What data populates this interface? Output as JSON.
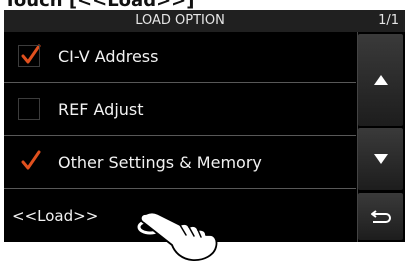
{
  "top_caption_partial": "Touch [<<Load>>]",
  "screen": {
    "title": "LOAD OPTION",
    "page_indicator": "1/1",
    "options": [
      {
        "label": "CI-V Address",
        "checked": true
      },
      {
        "label": "REF Adjust",
        "checked": false
      },
      {
        "label": "Other Settings & Memory",
        "checked": true
      }
    ],
    "load_label": "<<Load>>",
    "buttons": {
      "up": "up-arrow-icon",
      "down": "down-arrow-icon",
      "back": "return-icon"
    },
    "colors": {
      "check": "#e0501e",
      "background": "#000000",
      "text": "#f2f2f2"
    }
  }
}
